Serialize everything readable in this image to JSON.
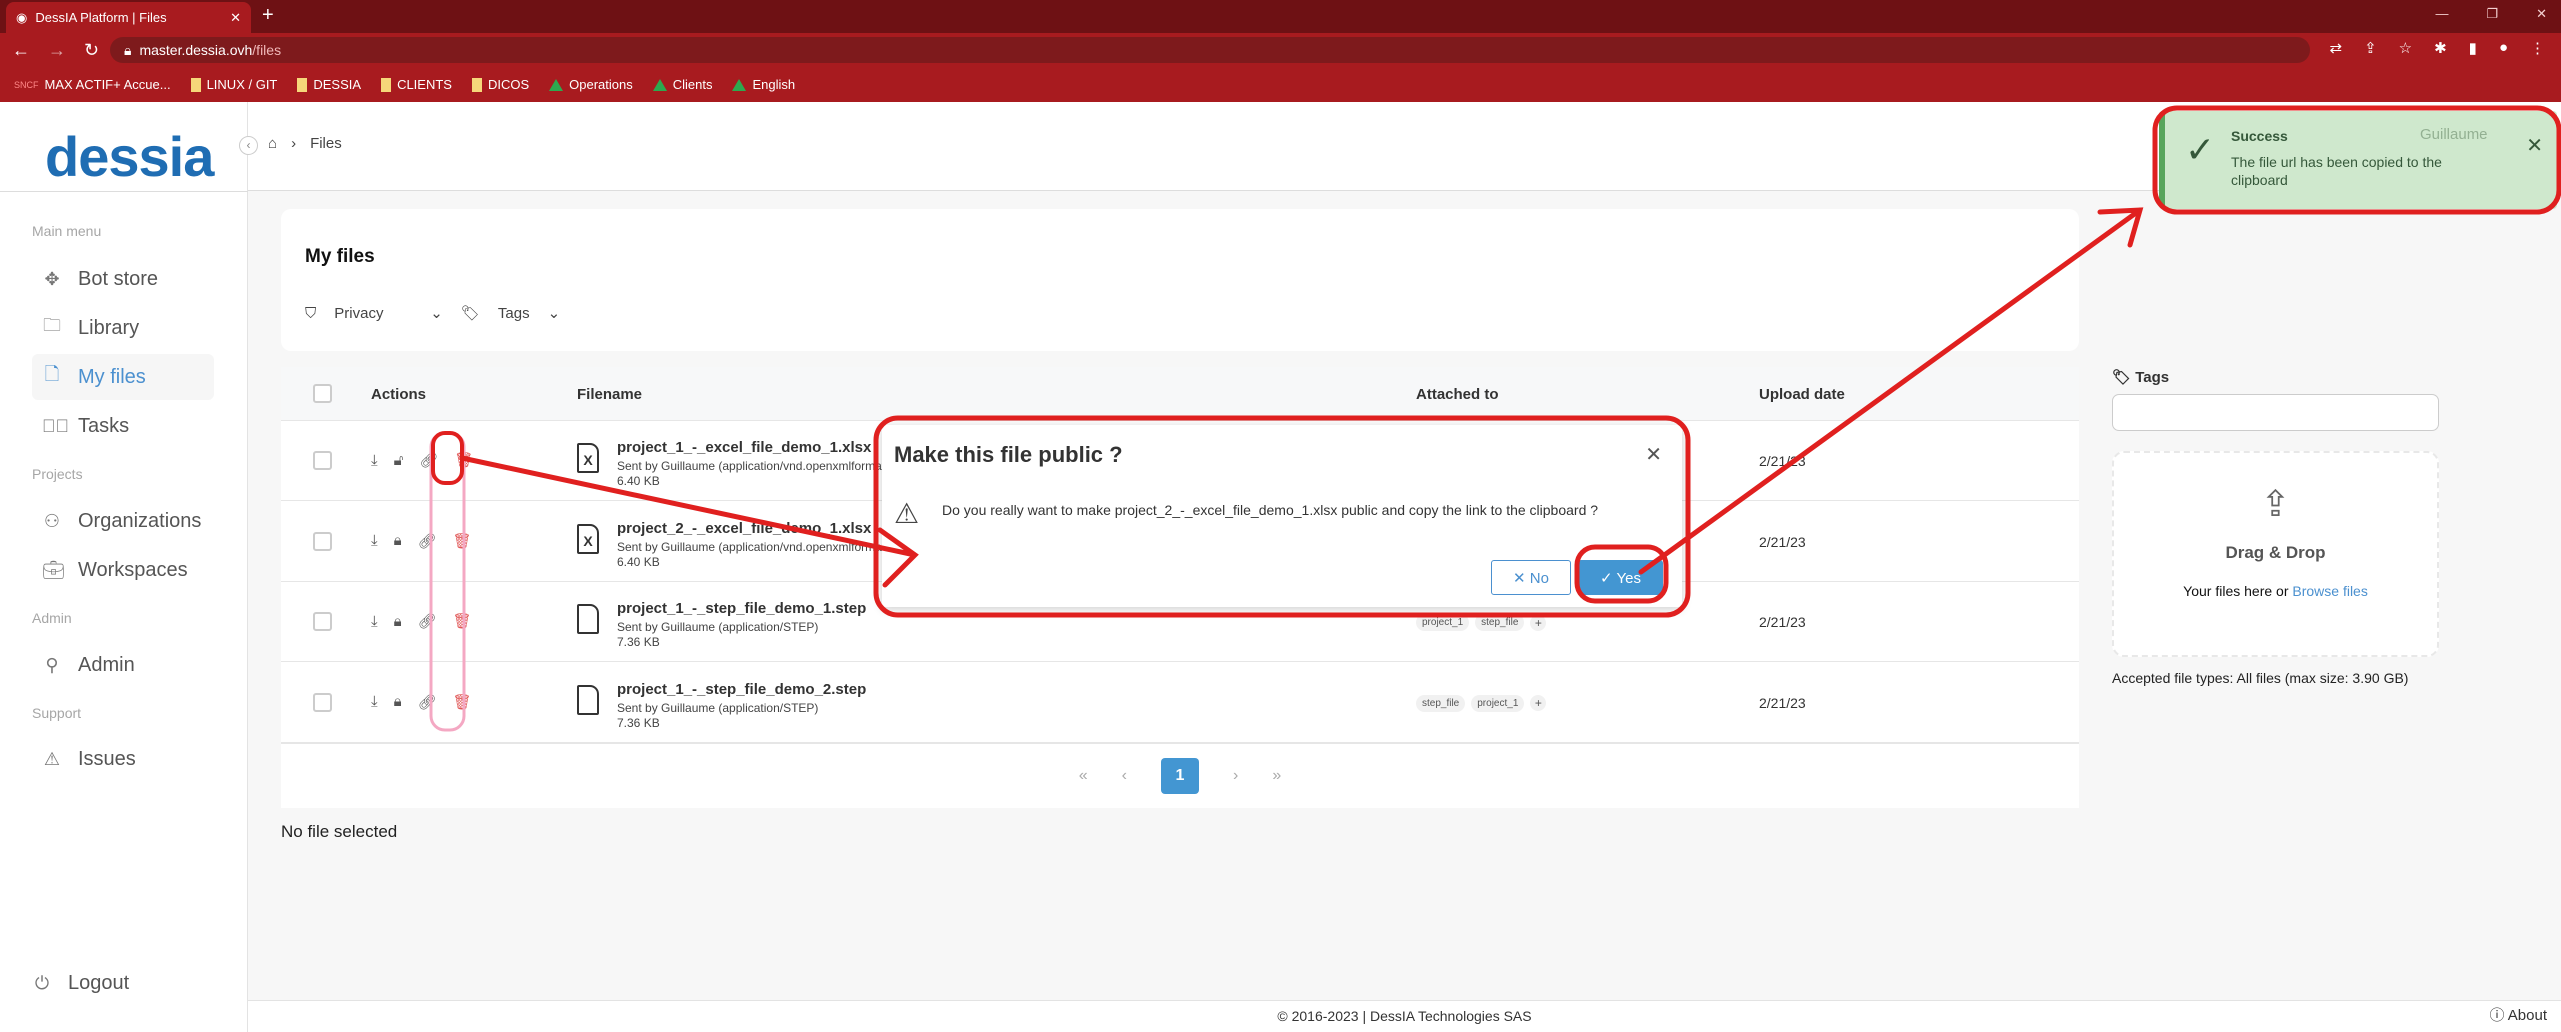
{
  "browser": {
    "tab_title": "DessIA Platform | Files",
    "url_host": "master.dessia.ovh",
    "url_path": "/files",
    "bookmarks": [
      "MAX ACTIF+ Accue...",
      "LINUX / GIT",
      "DESSIA",
      "CLIENTS",
      "DICOS",
      "Operations",
      "Clients",
      "English"
    ]
  },
  "sidebar": {
    "logo": "dessia",
    "sections": {
      "main": "Main menu",
      "projects": "Projects",
      "admin": "Admin",
      "support": "Support"
    },
    "items": {
      "bot_store": "Bot store",
      "library": "Library",
      "my_files": "My files",
      "tasks": "Tasks",
      "organizations": "Organizations",
      "workspaces": "Workspaces",
      "admin": "Admin",
      "issues": "Issues"
    },
    "logout": "Logout"
  },
  "header": {
    "breadcrumb": "Files",
    "user": "Guillaume"
  },
  "card": {
    "title": "My files",
    "filter_privacy": "Privacy",
    "filter_tags": "Tags"
  },
  "table": {
    "headers": {
      "actions": "Actions",
      "filename": "Filename",
      "attached": "Attached to",
      "date": "Upload date"
    },
    "rows": [
      {
        "name": "project_1_-_excel_file_demo_1.xlsx",
        "sent": "Sent by Guillaume (application/vnd.openxmlformats)",
        "size": "6.40 KB",
        "date": "2/21/23",
        "type": "excel",
        "lock": "unlocked",
        "tags": []
      },
      {
        "name": "project_2_-_excel_file_demo_1.xlsx",
        "sent": "Sent by Guillaume (application/vnd.openxmlformats)",
        "size": "6.40 KB",
        "date": "2/21/23",
        "type": "excel",
        "lock": "locked",
        "tags": []
      },
      {
        "name": "project_1_-_step_file_demo_1.step",
        "sent": "Sent by Guillaume (application/STEP)",
        "size": "7.36 KB",
        "date": "2/21/23",
        "type": "step",
        "lock": "locked",
        "tags": [
          "project_1",
          "step_file"
        ]
      },
      {
        "name": "project_1_-_step_file_demo_2.step",
        "sent": "Sent by Guillaume (application/STEP)",
        "size": "7.36 KB",
        "date": "2/21/23",
        "type": "step",
        "lock": "locked",
        "tags": [
          "step_file",
          "project_1"
        ]
      }
    ]
  },
  "pagination": {
    "current": "1"
  },
  "no_file": "No file selected",
  "right_panel": {
    "tags_label": "Tags",
    "drag_drop": "Drag & Drop",
    "your_files": "Your files here or",
    "browse": "Browse files",
    "accepted": "Accepted file types: All files (max size: 3.90 GB)"
  },
  "footer": {
    "copyright": "© 2016-2023 | DessIA Technologies SAS",
    "about": "About"
  },
  "modal": {
    "title": "Make this file public ?",
    "body": "Do you really want to make project_2_-_excel_file_demo_1.xlsx public and copy the link to the clipboard ?",
    "no": "No",
    "yes": "Yes"
  },
  "toast": {
    "title": "Success",
    "message": "The file url has been copied to the clipboard"
  },
  "colors": {
    "accent": "#4396d2",
    "browser": "#a81b1f",
    "toast_bg": "#cfe8cd",
    "annotation": "#e0201f"
  }
}
